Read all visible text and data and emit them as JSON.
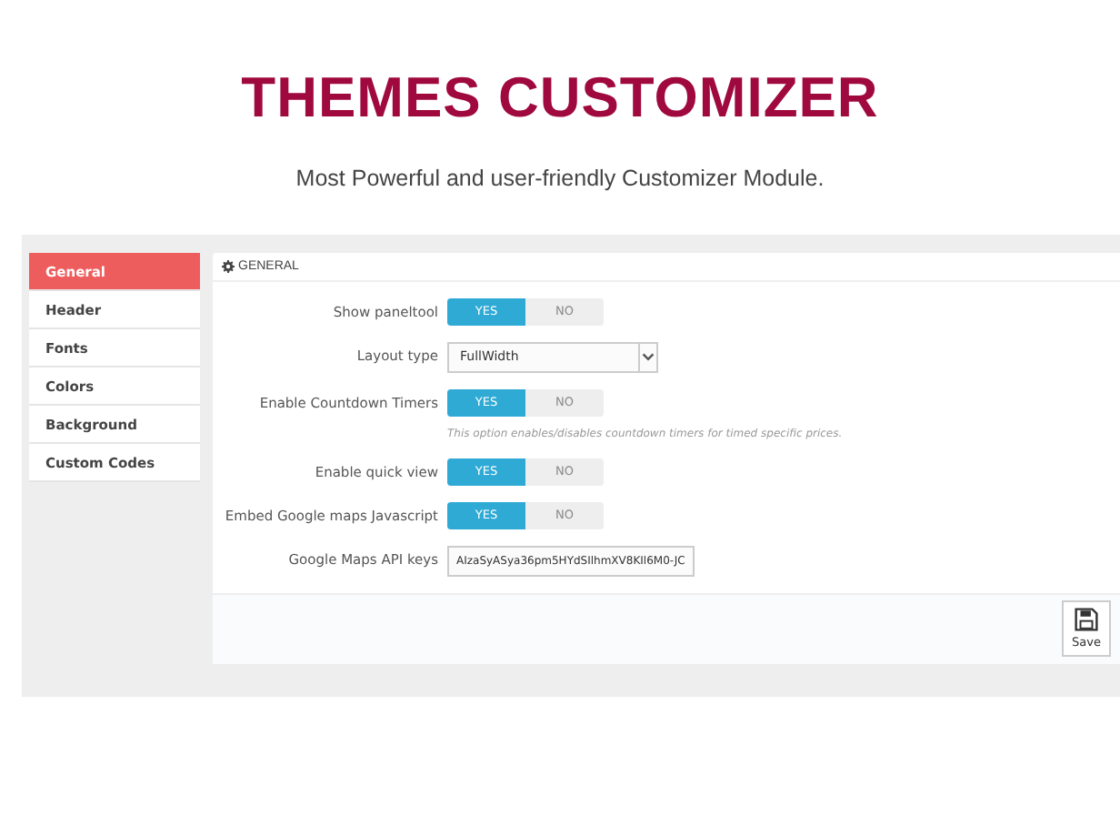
{
  "header": {
    "title": "THEMES CUSTOMIZER",
    "subtitle": "Most Powerful and user-friendly Customizer Module."
  },
  "sidebar": {
    "items": [
      {
        "label": "General",
        "selected": true
      },
      {
        "label": "Header",
        "selected": false
      },
      {
        "label": "Fonts",
        "selected": false
      },
      {
        "label": "Colors",
        "selected": false
      },
      {
        "label": "Background",
        "selected": false
      },
      {
        "label": "Custom Codes",
        "selected": false
      }
    ]
  },
  "panel": {
    "title": "GENERAL",
    "fields": [
      {
        "kind": "toggle",
        "label": "Show paneltool",
        "yes": "YES",
        "no": "NO",
        "on": true
      },
      {
        "kind": "select",
        "label": "Layout type",
        "value": "FullWidth"
      },
      {
        "kind": "toggle",
        "label": "Enable Countdown Timers",
        "yes": "YES",
        "no": "NO",
        "on": true,
        "help": "This option enables/disables countdown timers for timed specific prices."
      },
      {
        "kind": "toggle",
        "label": "Enable quick view",
        "yes": "YES",
        "no": "NO",
        "on": true
      },
      {
        "kind": "toggle",
        "label": "Embed Google maps Javascript",
        "yes": "YES",
        "no": "NO",
        "on": true
      },
      {
        "kind": "text",
        "label": "Google Maps API keys",
        "value": "AIzaSyASya36pm5HYdSIlhmXV8KIl6M0-JC"
      }
    ],
    "save": "Save"
  }
}
